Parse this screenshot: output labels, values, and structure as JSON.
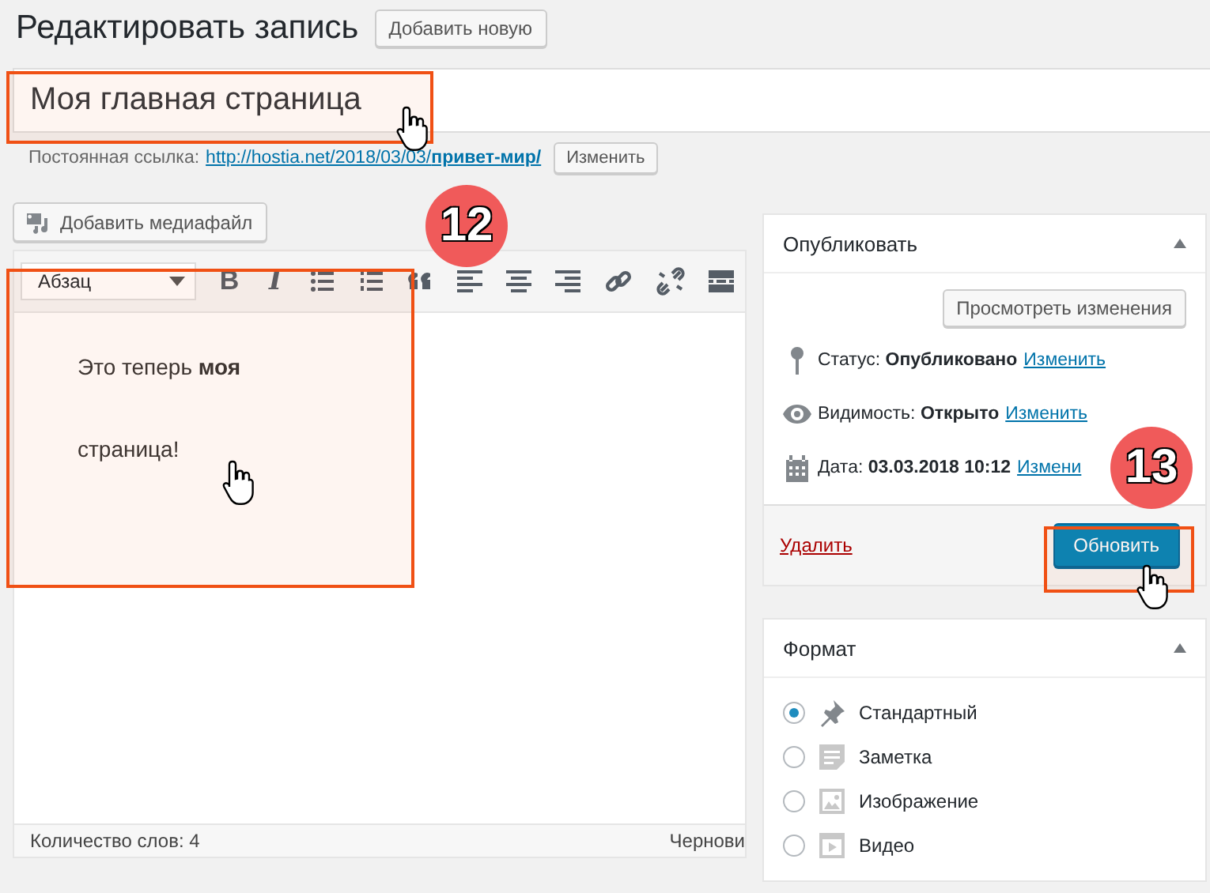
{
  "heading": "Редактировать запись",
  "add_new_button": "Добавить новую",
  "title_field": {
    "value": "Моя главная страница"
  },
  "permalink": {
    "label": "Постоянная ссылка:",
    "url": "http://hostia.net/2018/03/03/**привет-мир/**",
    "edit_button": "Изменить"
  },
  "media_button": "Добавить медиафайл",
  "editor": {
    "format_select": "Абзац",
    "toolbar": [
      {
        "kind": "bold",
        "label": "B"
      },
      {
        "kind": "italic",
        "label": "I"
      },
      {
        "kind": "bullet-list"
      },
      {
        "kind": "number-list"
      },
      {
        "kind": "quote"
      },
      {
        "kind": "align-left"
      },
      {
        "kind": "align-center"
      },
      {
        "kind": "align-right"
      },
      {
        "kind": "link"
      },
      {
        "kind": "unlink"
      },
      {
        "kind": "more"
      }
    ],
    "content": "Это теперь **моя** страница!",
    "word_count": "Количество слов: 4",
    "draft_status": "Чернови"
  },
  "publish_box": {
    "title": "Опубликовать",
    "expanded": true,
    "preview_button": "Просмотреть изменения",
    "rows": [
      {
        "kind": "status",
        "text": "Статус: **Опубликовано**",
        "link": "Изменить"
      },
      {
        "kind": "visibility",
        "text": "Видимость: **Открыто**",
        "link": "Изменить"
      },
      {
        "kind": "date",
        "text": "Дата: **03.03.2018 10:12**",
        "link": "Измени"
      }
    ],
    "delete_link": "Удалить",
    "update_button": "Обновить"
  },
  "format_box": {
    "title": "Формат",
    "expanded": true,
    "options": [
      {
        "kind": "standard",
        "label": "Стандартный",
        "selected": true
      },
      {
        "kind": "aside",
        "label": "Заметка",
        "selected": false
      },
      {
        "kind": "image",
        "label": "Изображение",
        "selected": false
      },
      {
        "kind": "video",
        "label": "Видео",
        "selected": false
      }
    ]
  },
  "annotations": [
    {
      "label": "12"
    },
    {
      "label": "13"
    }
  ]
}
